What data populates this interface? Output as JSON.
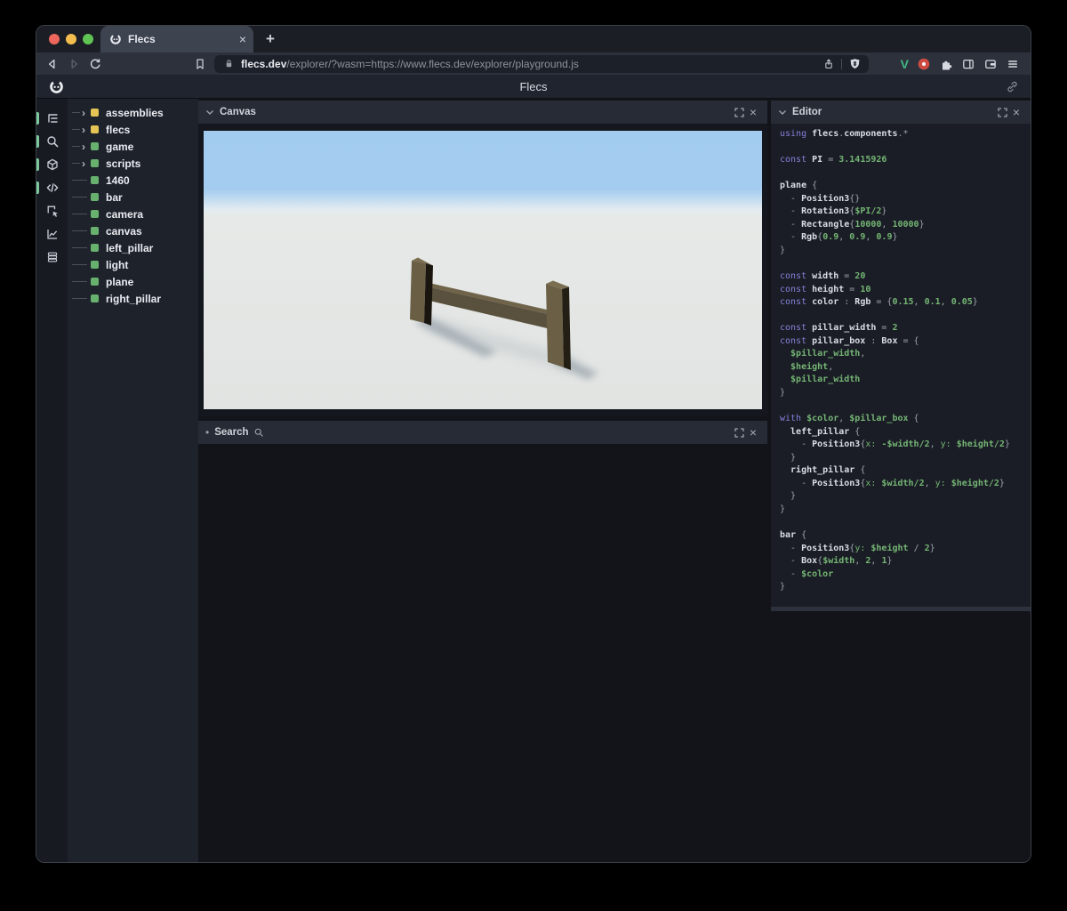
{
  "browser": {
    "window_controls": [
      "close",
      "minimize",
      "maximize"
    ],
    "tab": {
      "title": "Flecs"
    },
    "tab_close_glyph": "×",
    "new_tab_button": "+",
    "url": {
      "domain": "flecs.dev",
      "path": "/explorer/?wasm=https://www.flecs.dev/explorer/playground.js"
    },
    "extensions": {
      "vue_label": "V",
      "vue_color": "#42b883"
    }
  },
  "app_header": {
    "title": "Flecs"
  },
  "icon_strip": [
    {
      "name": "outline-tree-icon",
      "active": true
    },
    {
      "name": "query-search-icon",
      "active": true
    },
    {
      "name": "entities-cube-icon",
      "active": true
    },
    {
      "name": "script-code-icon",
      "active": true
    },
    {
      "name": "inspect-cursor-icon",
      "active": false
    },
    {
      "name": "stats-chart-icon",
      "active": false
    },
    {
      "name": "commands-rows-icon",
      "active": false
    }
  ],
  "tree": {
    "expand_glyph": "›",
    "items": [
      {
        "label": "assemblies",
        "color": "#e4c454",
        "expandable": true
      },
      {
        "label": "flecs",
        "color": "#e4c454",
        "expandable": true
      },
      {
        "label": "game",
        "color": "#68b06e",
        "expandable": true
      },
      {
        "label": "scripts",
        "color": "#68b06e",
        "expandable": true
      },
      {
        "label": "1460",
        "color": "#68b06e",
        "expandable": false
      },
      {
        "label": "bar",
        "color": "#68b06e",
        "expandable": false
      },
      {
        "label": "camera",
        "color": "#68b06e",
        "expandable": false
      },
      {
        "label": "canvas",
        "color": "#68b06e",
        "expandable": false
      },
      {
        "label": "left_pillar",
        "color": "#68b06e",
        "expandable": false
      },
      {
        "label": "light",
        "color": "#68b06e",
        "expandable": false
      },
      {
        "label": "plane",
        "color": "#68b06e",
        "expandable": false
      },
      {
        "label": "right_pillar",
        "color": "#68b06e",
        "expandable": false
      }
    ]
  },
  "panels": {
    "close_glyph": "×",
    "canvas": {
      "title": "Canvas"
    },
    "search": {
      "title": "Search",
      "collapsed_glyph": "•"
    },
    "editor": {
      "title": "Editor"
    }
  },
  "scene": {
    "sky_color": "#a2cbf0",
    "ground_color": "#e2e5e2",
    "wood_light": "#6a5e45",
    "wood_top": "#7a6d50",
    "wood_dark": "#1a160f",
    "shadow_color": "#99a3ad"
  },
  "editor_code": {
    "lines": [
      [
        [
          "k",
          "using "
        ],
        [
          "i",
          "flecs"
        ],
        [
          "p",
          "."
        ],
        [
          "i",
          "components"
        ],
        [
          "p",
          ".*"
        ]
      ],
      [],
      [
        [
          "k",
          "const "
        ],
        [
          "i",
          "PI"
        ],
        [
          "p",
          " = "
        ],
        [
          "n",
          "3.1415926"
        ]
      ],
      [],
      [
        [
          "i",
          "plane"
        ],
        [
          "p",
          " {"
        ]
      ],
      [
        [
          "p",
          "  - "
        ],
        [
          "i",
          "Position3"
        ],
        [
          "p",
          "{}"
        ]
      ],
      [
        [
          "p",
          "  - "
        ],
        [
          "i",
          "Rotation3"
        ],
        [
          "p",
          "{"
        ],
        [
          "n",
          "$PI/2"
        ],
        [
          "p",
          "}"
        ]
      ],
      [
        [
          "p",
          "  - "
        ],
        [
          "i",
          "Rectangle"
        ],
        [
          "p",
          "{"
        ],
        [
          "n",
          "10000"
        ],
        [
          "p",
          ", "
        ],
        [
          "n",
          "10000"
        ],
        [
          "p",
          "}"
        ]
      ],
      [
        [
          "p",
          "  - "
        ],
        [
          "i",
          "Rgb"
        ],
        [
          "p",
          "{"
        ],
        [
          "n",
          "0.9"
        ],
        [
          "p",
          ", "
        ],
        [
          "n",
          "0.9"
        ],
        [
          "p",
          ", "
        ],
        [
          "n",
          "0.9"
        ],
        [
          "p",
          "}"
        ]
      ],
      [
        [
          "p",
          "}"
        ]
      ],
      [],
      [
        [
          "k",
          "const "
        ],
        [
          "i",
          "width"
        ],
        [
          "p",
          " = "
        ],
        [
          "n",
          "20"
        ]
      ],
      [
        [
          "k",
          "const "
        ],
        [
          "i",
          "height"
        ],
        [
          "p",
          " = "
        ],
        [
          "n",
          "10"
        ]
      ],
      [
        [
          "k",
          "const "
        ],
        [
          "i",
          "color"
        ],
        [
          "p",
          " : "
        ],
        [
          "i",
          "Rgb"
        ],
        [
          "p",
          " = {"
        ],
        [
          "n",
          "0.15"
        ],
        [
          "p",
          ", "
        ],
        [
          "n",
          "0.1"
        ],
        [
          "p",
          ", "
        ],
        [
          "n",
          "0.05"
        ],
        [
          "p",
          "}"
        ]
      ],
      [],
      [
        [
          "k",
          "const "
        ],
        [
          "i",
          "pillar_width"
        ],
        [
          "p",
          " = "
        ],
        [
          "n",
          "2"
        ]
      ],
      [
        [
          "k",
          "const "
        ],
        [
          "i",
          "pillar_box"
        ],
        [
          "p",
          " : "
        ],
        [
          "i",
          "Box"
        ],
        [
          "p",
          " = {"
        ]
      ],
      [
        [
          "n",
          "  $pillar_width"
        ],
        [
          "p",
          ","
        ]
      ],
      [
        [
          "n",
          "  $height"
        ],
        [
          "p",
          ","
        ]
      ],
      [
        [
          "n",
          "  $pillar_width"
        ]
      ],
      [
        [
          "p",
          "}"
        ]
      ],
      [],
      [
        [
          "k",
          "with "
        ],
        [
          "n",
          "$color"
        ],
        [
          "p",
          ", "
        ],
        [
          "n",
          "$pillar_box"
        ],
        [
          "p",
          " {"
        ]
      ],
      [
        [
          "i",
          "  left_pillar"
        ],
        [
          "p",
          " {"
        ]
      ],
      [
        [
          "p",
          "    - "
        ],
        [
          "i",
          "Position3"
        ],
        [
          "p",
          "{"
        ],
        [
          "g",
          "x:"
        ],
        [
          "p",
          " "
        ],
        [
          "n",
          "-$width/2"
        ],
        [
          "p",
          ", "
        ],
        [
          "g",
          "y:"
        ],
        [
          "p",
          " "
        ],
        [
          "n",
          "$height/2"
        ],
        [
          "p",
          "}"
        ]
      ],
      [
        [
          "p",
          "  }"
        ]
      ],
      [
        [
          "i",
          "  right_pillar"
        ],
        [
          "p",
          " {"
        ]
      ],
      [
        [
          "p",
          "    - "
        ],
        [
          "i",
          "Position3"
        ],
        [
          "p",
          "{"
        ],
        [
          "g",
          "x:"
        ],
        [
          "p",
          " "
        ],
        [
          "n",
          "$width/2"
        ],
        [
          "p",
          ", "
        ],
        [
          "g",
          "y:"
        ],
        [
          "p",
          " "
        ],
        [
          "n",
          "$height/2"
        ],
        [
          "p",
          "}"
        ]
      ],
      [
        [
          "p",
          "  }"
        ]
      ],
      [
        [
          "p",
          "}"
        ]
      ],
      [],
      [
        [
          "i",
          "bar"
        ],
        [
          "p",
          " {"
        ]
      ],
      [
        [
          "p",
          "  - "
        ],
        [
          "i",
          "Position3"
        ],
        [
          "p",
          "{"
        ],
        [
          "g",
          "y:"
        ],
        [
          "p",
          " "
        ],
        [
          "n",
          "$height"
        ],
        [
          "p",
          " / "
        ],
        [
          "n",
          "2"
        ],
        [
          "p",
          "}"
        ]
      ],
      [
        [
          "p",
          "  - "
        ],
        [
          "i",
          "Box"
        ],
        [
          "p",
          "{"
        ],
        [
          "n",
          "$width"
        ],
        [
          "p",
          ", "
        ],
        [
          "n",
          "2"
        ],
        [
          "p",
          ", "
        ],
        [
          "n",
          "1"
        ],
        [
          "p",
          "}"
        ]
      ],
      [
        [
          "p",
          "  - "
        ],
        [
          "n",
          "$color"
        ]
      ],
      [
        [
          "p",
          "}"
        ]
      ]
    ]
  },
  "theme": {
    "keyword_color": "#8480d8",
    "identifier_color": "#d8dbe2",
    "value_color": "#74b474",
    "punct_color": "#9aa0ab",
    "active_indicator": "#7cc79b"
  }
}
